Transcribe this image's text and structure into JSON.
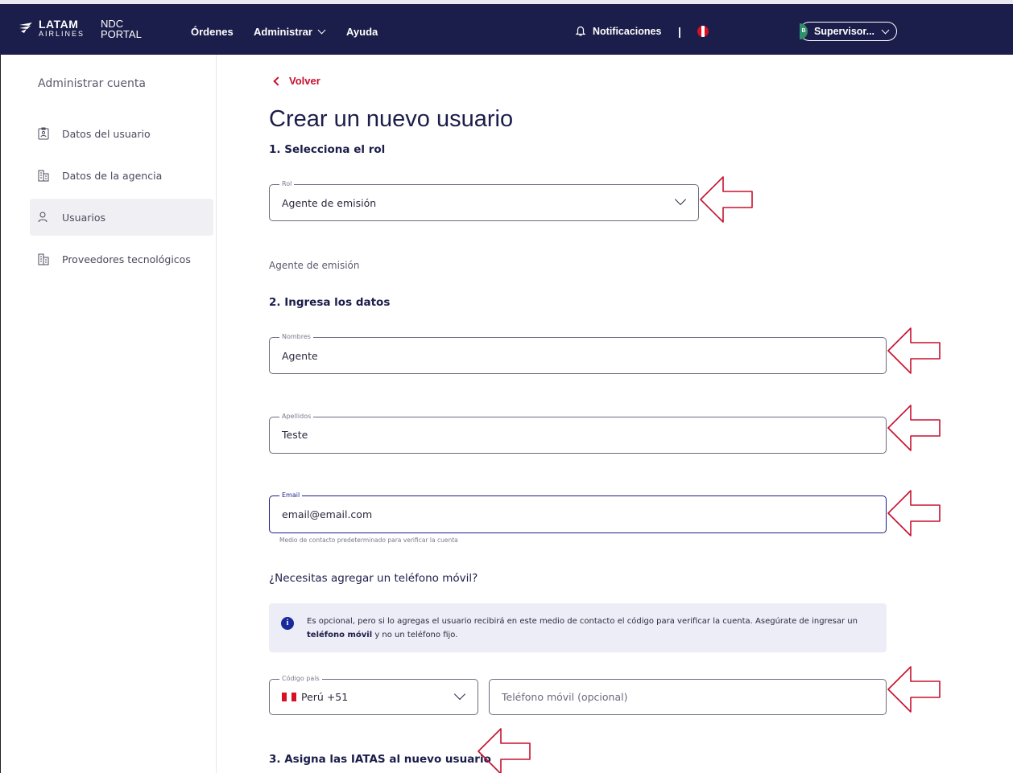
{
  "header": {
    "logo_line1": "LATAM",
    "logo_line2": "AIRLINES",
    "portal_line1": "NDC",
    "portal_line2": "PORTAL",
    "nav": [
      "Órdenes",
      "Administrar",
      "Ayuda"
    ],
    "notifications": "Notificaciones",
    "separator": "|",
    "user_initial": "B",
    "user_label": "Supervisor..."
  },
  "sidebar": {
    "title": "Administrar cuenta",
    "items": [
      {
        "label": "Datos del usuario",
        "icon": "id-badge-icon",
        "active": false
      },
      {
        "label": "Datos de la agencia",
        "icon": "building-icon",
        "active": false
      },
      {
        "label": "Usuarios",
        "icon": "user-icon",
        "active": true
      },
      {
        "label": "Proveedores tecnológicos",
        "icon": "building-icon",
        "active": false
      }
    ]
  },
  "main": {
    "back_label": "Volver",
    "title": "Crear un nuevo usuario",
    "step1": "1. Selecciona el rol",
    "role_field": {
      "label": "Rol",
      "value": "Agente de emisión"
    },
    "role_selected_text": "Agente de emisión",
    "step2": "2. Ingresa los datos",
    "first_name": {
      "label": "Nombres",
      "value": "Agente"
    },
    "last_name": {
      "label": "Apellidos",
      "value": "Teste"
    },
    "email": {
      "label": "Email",
      "value": "email@email.com",
      "helper": "Medio de contacto predeterminado para verificar la cuenta"
    },
    "phone_question": "¿Necesitas agregar un teléfono móvil?",
    "info_text_1": "Es opcional, pero si lo agregas el usuario recibirá en este medio de contacto el código para verificar la cuenta. Asegúrate de ingresar un",
    "info_bold": "teléfono móvil",
    "info_text_2": "y no un teléfono fijo.",
    "country_code": {
      "label": "Código país",
      "value": "Perú +51"
    },
    "phone": {
      "placeholder": "Teléfono móvil (opcional)"
    },
    "step3": "3. Asigna las IATAS al nuevo usuario"
  },
  "colors": {
    "header_bg": "#1b1d4a",
    "accent_red": "#c8102e",
    "annotation_arrow": "#c8102e",
    "info_bg": "#ededf7",
    "focus_border": "#1b1d8a"
  }
}
